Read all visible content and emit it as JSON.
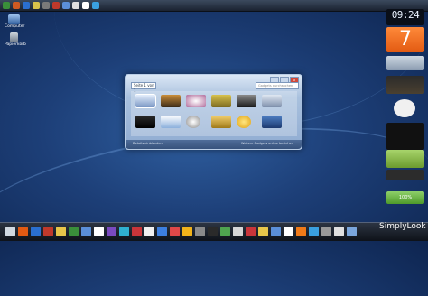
{
  "desktop": {
    "icons": [
      {
        "label": "Computer"
      },
      {
        "label": "Papierkorb"
      }
    ]
  },
  "gadget_window": {
    "pager": "Seite 1 von 1",
    "search_placeholder": "Gadgets durchsuchen",
    "footer_left": "Details einblenden",
    "footer_right": "Weitere Gadgets online beziehen",
    "close_glyph": "x"
  },
  "sidebar": {
    "clock_time": "09:24",
    "calendar_day": "7",
    "battery_percent": "100%"
  },
  "branding": {
    "text": "SimplyLook"
  },
  "colors": {
    "desktop_dark": "#0e2550",
    "desktop_mid": "#2f5fa0",
    "calendar_orange": "#e25a12",
    "window_glass": "#a9c1de"
  }
}
